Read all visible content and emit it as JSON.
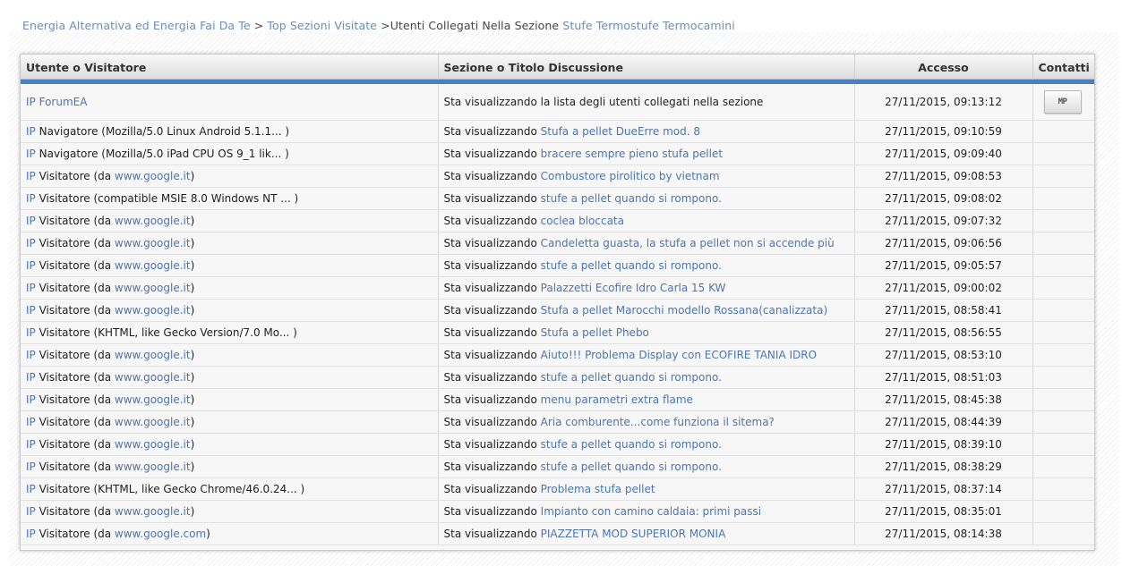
{
  "breadcrumb": {
    "site": "Energia Alternativa ed Energia Fai Da Te",
    "sep1": " > ",
    "top": "Top Sezioni Visitate",
    "sep2": " >",
    "current": "Utenti Collegati Nella Sezione",
    "section": "Stufe Termostufe Termocamini"
  },
  "table": {
    "headers": {
      "user": "Utente o Visitatore",
      "section": "Sezione o Titolo Discussione",
      "access": "Accesso",
      "contacts": "Contatti"
    },
    "mp_label": "MP",
    "rows": [
      {
        "ip": "IP",
        "user_prefix": "",
        "user_link": "ForumEA",
        "user_suffix": "",
        "action": "Sta visualizzando la lista degli utenti collegati nella sezione",
        "topic": "",
        "time": "27/11/2015, 09:13:12",
        "mp": true
      },
      {
        "ip": "IP",
        "user_prefix": "Navigatore (Mozilla/5.0 Linux Android 5.1.1... )",
        "user_link": "",
        "user_suffix": "",
        "action": "Sta visualizzando",
        "topic": "Stufa a pellet DueErre mod. 8",
        "time": "27/11/2015, 09:10:59"
      },
      {
        "ip": "IP",
        "user_prefix": "Navigatore (Mozilla/5.0 iPad CPU OS 9_1 lik... )",
        "user_link": "",
        "user_suffix": "",
        "action": "Sta visualizzando",
        "topic": "bracere sempre pieno stufa pellet",
        "time": "27/11/2015, 09:09:40"
      },
      {
        "ip": "IP",
        "user_prefix": "Visitatore (da ",
        "user_link": "www.google.it",
        "user_suffix": ")",
        "action": "Sta visualizzando",
        "topic": "Combustore pirolitico by vietnam",
        "time": "27/11/2015, 09:08:53"
      },
      {
        "ip": "IP",
        "user_prefix": "Visitatore (compatible MSIE 8.0 Windows NT ... )",
        "user_link": "",
        "user_suffix": "",
        "action": "Sta visualizzando",
        "topic": "stufe a pellet quando si rompono.",
        "time": "27/11/2015, 09:08:02"
      },
      {
        "ip": "IP",
        "user_prefix": "Visitatore (da ",
        "user_link": "www.google.it",
        "user_suffix": ")",
        "action": "Sta visualizzando",
        "topic": "coclea bloccata",
        "time": "27/11/2015, 09:07:32"
      },
      {
        "ip": "IP",
        "user_prefix": "Visitatore (da ",
        "user_link": "www.google.it",
        "user_suffix": ")",
        "action": "Sta visualizzando",
        "topic": "Candeletta guasta, la stufa a pellet non si accende più",
        "time": "27/11/2015, 09:06:56"
      },
      {
        "ip": "IP",
        "user_prefix": "Visitatore (da ",
        "user_link": "www.google.it",
        "user_suffix": ")",
        "action": "Sta visualizzando",
        "topic": "stufe a pellet quando si rompono.",
        "time": "27/11/2015, 09:05:57"
      },
      {
        "ip": "IP",
        "user_prefix": "Visitatore (da ",
        "user_link": "www.google.it",
        "user_suffix": ")",
        "action": "Sta visualizzando",
        "topic": "Palazzetti Ecofire Idro Carla 15 KW",
        "time": "27/11/2015, 09:00:02"
      },
      {
        "ip": "IP",
        "user_prefix": "Visitatore (da ",
        "user_link": "www.google.it",
        "user_suffix": ")",
        "action": "Sta visualizzando",
        "topic": "Stufa a pellet Marocchi modello Rossana(canalizzata)",
        "time": "27/11/2015, 08:58:41"
      },
      {
        "ip": "IP",
        "user_prefix": "Visitatore (KHTML, like Gecko Version/7.0 Mo... )",
        "user_link": "",
        "user_suffix": "",
        "action": "Sta visualizzando",
        "topic": "Stufa a pellet Phebo",
        "time": "27/11/2015, 08:56:55"
      },
      {
        "ip": "IP",
        "user_prefix": "Visitatore (da ",
        "user_link": "www.google.it",
        "user_suffix": ")",
        "action": "Sta visualizzando",
        "topic": "Aiuto!!! Problema Display con ECOFIRE TANIA IDRO",
        "time": "27/11/2015, 08:53:10"
      },
      {
        "ip": "IP",
        "user_prefix": "Visitatore (da ",
        "user_link": "www.google.it",
        "user_suffix": ")",
        "action": "Sta visualizzando",
        "topic": "stufe a pellet quando si rompono.",
        "time": "27/11/2015, 08:51:03"
      },
      {
        "ip": "IP",
        "user_prefix": "Visitatore (da ",
        "user_link": "www.google.it",
        "user_suffix": ")",
        "action": "Sta visualizzando",
        "topic": "menu parametri extra flame",
        "time": "27/11/2015, 08:45:38"
      },
      {
        "ip": "IP",
        "user_prefix": "Visitatore (da ",
        "user_link": "www.google.it",
        "user_suffix": ")",
        "action": "Sta visualizzando",
        "topic": "Aria comburente...come funziona il sitema?",
        "time": "27/11/2015, 08:44:39"
      },
      {
        "ip": "IP",
        "user_prefix": "Visitatore (da ",
        "user_link": "www.google.it",
        "user_suffix": ")",
        "action": "Sta visualizzando",
        "topic": "stufe a pellet quando si rompono.",
        "time": "27/11/2015, 08:39:10"
      },
      {
        "ip": "IP",
        "user_prefix": "Visitatore (da ",
        "user_link": "www.google.it",
        "user_suffix": ")",
        "action": "Sta visualizzando",
        "topic": "stufe a pellet quando si rompono.",
        "time": "27/11/2015, 08:38:29"
      },
      {
        "ip": "IP",
        "user_prefix": "Visitatore (KHTML, like Gecko Chrome/46.0.24... )",
        "user_link": "",
        "user_suffix": "",
        "action": "Sta visualizzando",
        "topic": "Problema stufa pellet",
        "time": "27/11/2015, 08:37:14"
      },
      {
        "ip": "IP",
        "user_prefix": "Visitatore (da ",
        "user_link": "www.google.it",
        "user_suffix": ")",
        "action": "Sta visualizzando",
        "topic": "Impianto con camino caldaia: primi passi",
        "time": "27/11/2015, 08:35:01"
      },
      {
        "ip": "IP",
        "user_prefix": "Visitatore (da ",
        "user_link": "www.google.com",
        "user_suffix": ")",
        "action": "Sta visualizzando",
        "topic": "PIAZZETTA MOD SUPERIOR MONIA",
        "time": "27/11/2015, 08:14:38"
      }
    ]
  },
  "colors": {
    "link": "#4d75ad",
    "header_accent": "#4a7fc0"
  }
}
